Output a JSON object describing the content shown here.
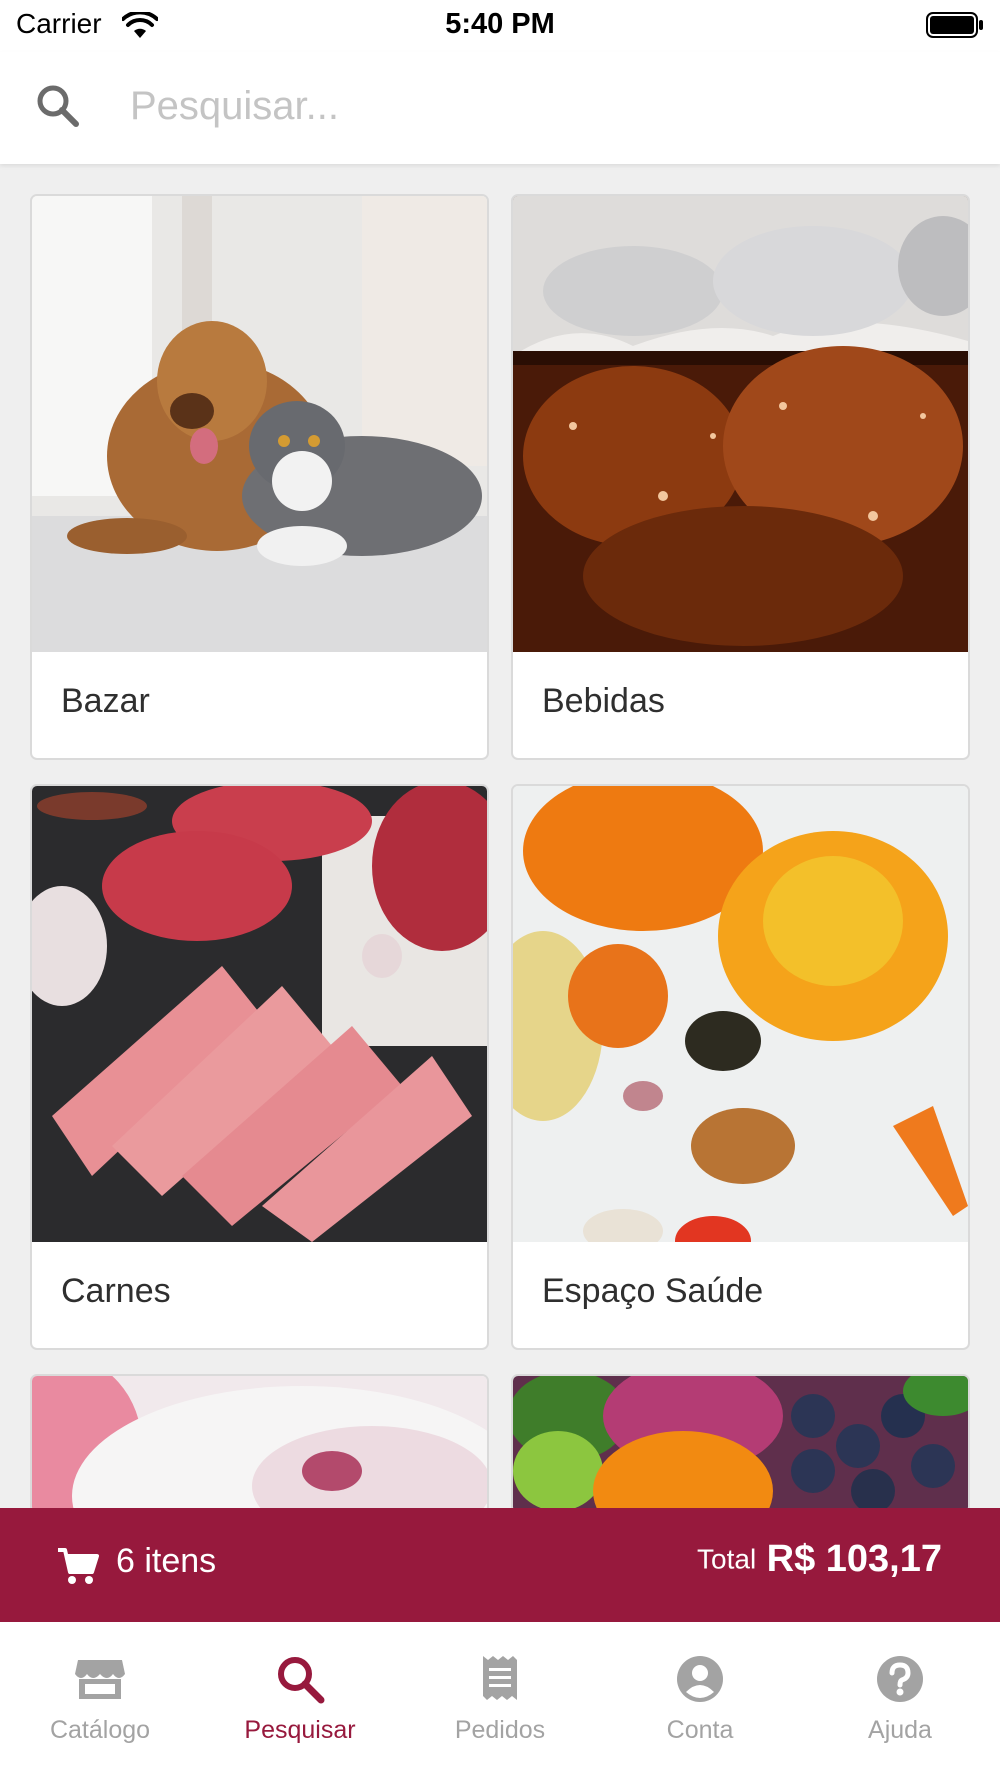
{
  "status_bar": {
    "carrier": "Carrier",
    "time": "5:40 PM"
  },
  "search": {
    "placeholder": "Pesquisar...",
    "value": ""
  },
  "categories": [
    {
      "label": "Bazar",
      "image": "dog-and-cat-photo"
    },
    {
      "label": "Bebidas",
      "image": "cola-with-ice-photo"
    },
    {
      "label": "Carnes",
      "image": "raw-meat-cuts-photo"
    },
    {
      "label": "Espaço Saúde",
      "image": "pumpkin-and-vegetables-photo"
    },
    {
      "label": "",
      "image": "ice-cream-photo"
    },
    {
      "label": "",
      "image": "fruits-and-vegetables-photo"
    }
  ],
  "cart": {
    "count_label": "6 itens",
    "total_label": "Total",
    "total_value": "R$ 103,17"
  },
  "tabs": [
    {
      "label": "Catálogo",
      "icon": "store-icon",
      "active": false
    },
    {
      "label": "Pesquisar",
      "icon": "search-icon",
      "active": true
    },
    {
      "label": "Pedidos",
      "icon": "receipt-icon",
      "active": false
    },
    {
      "label": "Conta",
      "icon": "account-icon",
      "active": false
    },
    {
      "label": "Ajuda",
      "icon": "help-icon",
      "active": false
    }
  ],
  "colors": {
    "brand": "#97193d",
    "tab_inactive": "#a3a3a3",
    "background": "#efefef"
  }
}
